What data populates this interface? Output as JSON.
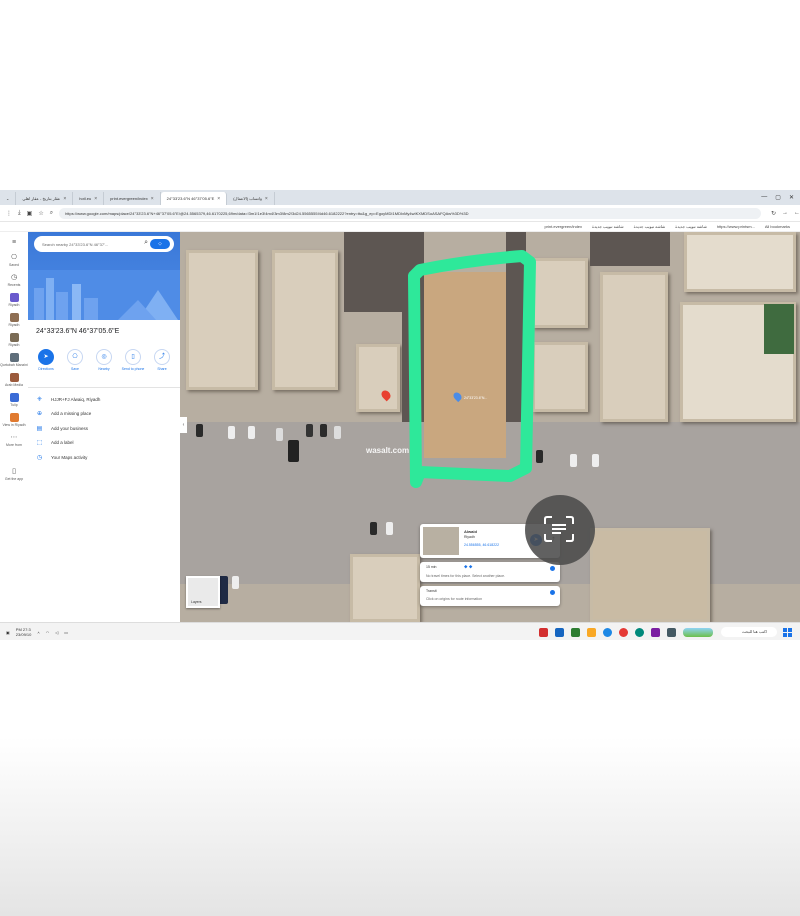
{
  "browser": {
    "tabs": [
      {
        "label": "واتساب (الاعمال)",
        "active": false
      },
      {
        "label": "24°33'23.6\"N 46°37'05.6\"E",
        "active": true
      },
      {
        "label": "print.evergreen/index",
        "active": false
      },
      {
        "label": "hotl.eu",
        "active": false
      },
      {
        "label": "عقار بتاريخ - عقار اهلي",
        "active": false
      }
    ],
    "url": "https://www.google.com/maps/place/24°33'23.6\"N+46°37'05.6\"E/@24.5565379,46.6170225,69m/data=!3m1!1e3!4m4!3m3!8m2!3d24.5565555!4d46.6182222?entry=ttu&g_ep=EgoyMDI1MDIxMy4wIKXMDSoASAFQAw%3D%3D",
    "bookmarks": [
      "All bookmarks",
      "https://www.printsm...",
      "شاشة تبويب جديدة",
      "شاشة تبويب جديدة",
      "شاشة تبويب جديدة",
      "print.evergreen/index"
    ]
  },
  "rail": {
    "items": [
      {
        "label": "Saved",
        "icon": "bookmark-icon"
      },
      {
        "label": "Recents",
        "icon": "history-icon"
      },
      {
        "label": "Riyadh",
        "icon": "thumbnail"
      },
      {
        "label": "Riyadh",
        "icon": "thumbnail"
      },
      {
        "label": "Riyadh",
        "icon": "thumbnail"
      },
      {
        "label": "Qurtubah Manzini",
        "icon": "thumbnail"
      },
      {
        "label": "Arab Media",
        "icon": "thumbnail"
      },
      {
        "label": "Tulip",
        "icon": "app"
      },
      {
        "label": "View in Riyadh",
        "icon": "app"
      },
      {
        "label": "More from",
        "icon": "more-icon"
      },
      {
        "label": "Get the app",
        "icon": "phone-icon"
      }
    ],
    "colors": [
      "#6a5acd",
      "#c0392b",
      "#e67e22",
      "#2ecc71",
      "#8e6e53",
      "#3a6bd6",
      "#e07a30"
    ]
  },
  "panel": {
    "search_placeholder": "Search nearby 24°33'23.6\"N 46°37'...",
    "coordinates": "24°33'23.6\"N 46°37'05.6\"E",
    "actions": [
      {
        "label": "Directions",
        "icon": "directions-icon"
      },
      {
        "label": "Save",
        "icon": "bookmark-icon"
      },
      {
        "label": "Nearby",
        "icon": "nearby-icon"
      },
      {
        "label": "Send to phone",
        "icon": "phone-icon"
      },
      {
        "label": "Share",
        "icon": "share-icon"
      }
    ],
    "info_rows": [
      {
        "text": "HJJR+FJ Alwaiq, Riyadh",
        "icon": "pluscode-icon"
      },
      {
        "text": "Add a missing place",
        "icon": "add-place-icon"
      },
      {
        "text": "Add your business",
        "icon": "business-icon"
      },
      {
        "text": "Add a label",
        "icon": "label-icon"
      },
      {
        "text": "Your Maps activity",
        "icon": "activity-icon"
      }
    ]
  },
  "map": {
    "watermark": "wasalt.com",
    "pin_label": "24°33'23.6\"N...",
    "highlight_color": "#2ee89a",
    "card_main": {
      "title": "Alwaid",
      "subtitle": "Riyadh",
      "coords": "24.556555, 46.618222"
    },
    "card_transit": {
      "time": "15 min",
      "text": "No travel times for this place. Select another place."
    },
    "card_timeline": {
      "title": "Transit",
      "text": "Click on origins for route information"
    },
    "layers_label": "Layers"
  },
  "taskbar": {
    "weather_temp": "PM 27:3",
    "date": "23/09/10",
    "search_text": "اكتب هنا للبحث",
    "app_colors": [
      "#d32f2f",
      "#1565c0",
      "#2e7d32",
      "#f9a825",
      "#1e88e5",
      "#e53935",
      "#7b1fa2",
      "#00897b",
      "#455a64"
    ]
  }
}
